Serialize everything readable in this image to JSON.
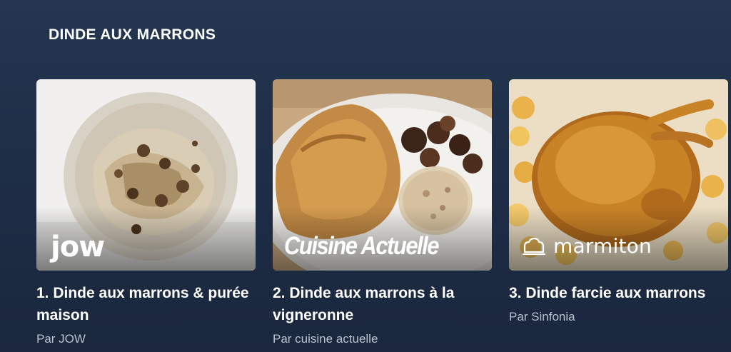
{
  "section": {
    "title": "DINDE AUX MARRONS"
  },
  "cards": [
    {
      "title": "1. Dinde aux marrons & purée maison",
      "source": "Par JOW",
      "brand": "jow",
      "image_icon": "turkey-chestnut-puree-plate"
    },
    {
      "title": "2. Dinde aux marrons à la vigneronne",
      "source": "Par cuisine actuelle",
      "brand": "Cuisine Actuelle",
      "image_icon": "turkey-chestnuts-stuffing-plate"
    },
    {
      "title": "3. Dinde farcie aux marrons",
      "source": "Par Sinfonia",
      "brand": "marmiton",
      "image_icon": "roast-turkey-potatoes"
    }
  ]
}
